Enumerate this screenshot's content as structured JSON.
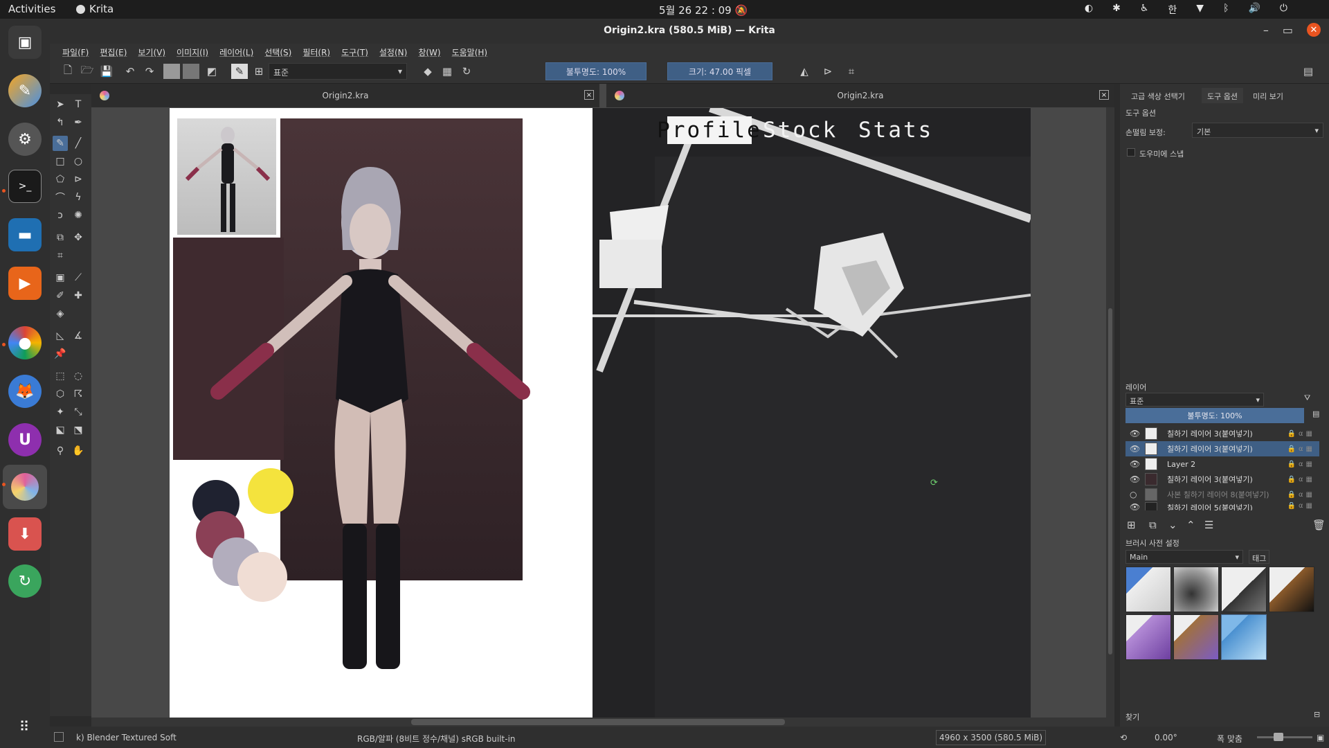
{
  "topbar": {
    "activities": "Activities",
    "app_name": "Krita",
    "clock": "5월 26  22 : 09",
    "ime": "한"
  },
  "window": {
    "title": "Origin2.kra (580.5 MiB) — Krita"
  },
  "menu": [
    "파일(F)",
    "편집(E)",
    "보기(V)",
    "이미지(I)",
    "레이어(L)",
    "선택(S)",
    "필터(R)",
    "도구(T)",
    "설정(N)",
    "창(W)",
    "도움말(H)"
  ],
  "toolbar": {
    "blend_mode": "표준",
    "opacity": "불투명도: 100%",
    "size": "크기: 47.00 픽셀"
  },
  "tabs": [
    {
      "name": "Origin2.kra",
      "close": "×"
    },
    {
      "name": "Origin2.kra",
      "close": "×"
    }
  ],
  "game_ui": {
    "tab1": "Profile",
    "tab2": "Stock",
    "tab3": "Stats"
  },
  "dockers": {
    "tabs": [
      "고급 색상 선택기",
      "도구 옵션",
      "미리 보기"
    ],
    "tool_options_title": "도구 옵션",
    "smoothing_label": "손떨림 보정:",
    "smoothing_value": "기본",
    "snap_label": "도우미에 스냅",
    "layers_title": "레이어",
    "layers_blend": "표준",
    "layers_opacity": "불투명도:  100%",
    "layers": [
      {
        "name": "칠하기 레이어 3(붙여넣기)",
        "visible": true,
        "selected": false
      },
      {
        "name": "칠하기 레이어 3(붙여넣기)",
        "visible": true,
        "selected": true
      },
      {
        "name": "Layer 2",
        "visible": true,
        "selected": false
      },
      {
        "name": "칠하기 레이어 3(붙여넣기)",
        "visible": true,
        "selected": false
      },
      {
        "name": "사본 칠하기 레이어 8(붙여넣기)",
        "visible": false,
        "selected": false
      },
      {
        "name": "칠하기 레이어 5(붙여넣기)",
        "visible": true,
        "selected": false
      }
    ],
    "brush_title": "브러시 사전 설정",
    "brush_tag": "Main",
    "tag_label": "태그",
    "search_label": "찾기"
  },
  "statusbar": {
    "brush": "k) Blender Textured Soft",
    "color": "RGB/알파 (8비트 정수/채널)  sRGB built-in",
    "dims": "4960 x 3500 (580.5 MiB)",
    "rotation": "0.00°",
    "zoom_fit": "폭 맞춤"
  },
  "colors": {
    "accent": "#4a6e99",
    "ubuntu_orange": "#e95420",
    "swatch_dark": "#1f2230",
    "swatch_wine": "#8b4056",
    "swatch_lavender": "#b2adbd",
    "swatch_blush": "#f0ddd4",
    "swatch_yellow": "#f4e33d"
  }
}
